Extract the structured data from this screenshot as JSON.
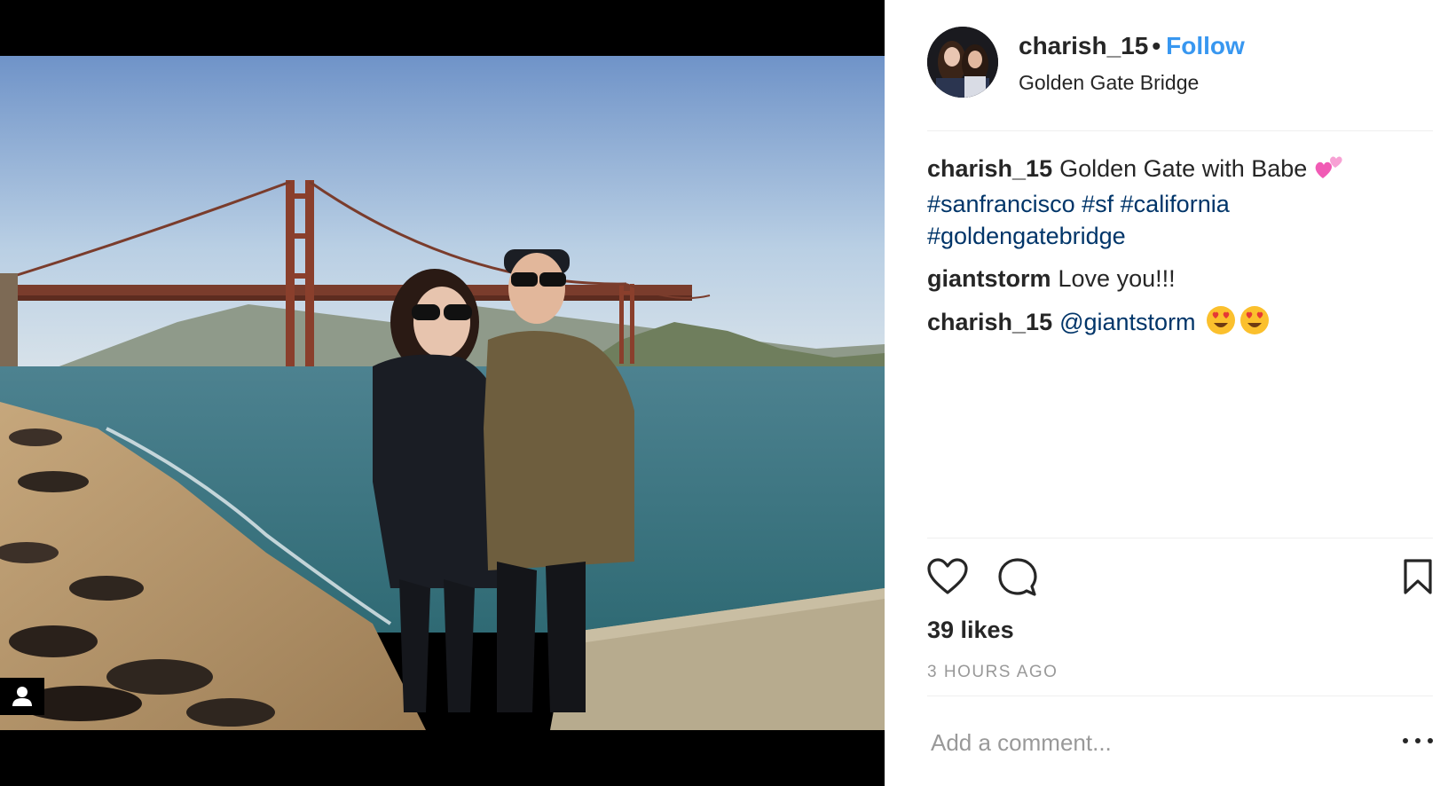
{
  "post": {
    "username": "charish_15",
    "separator": "•",
    "follow_label": "Follow",
    "location": "Golden Gate Bridge",
    "likes": "39 likes",
    "timestamp": "3 HOURS AGO"
  },
  "comments": [
    {
      "user": "charish_15",
      "text": "Golden Gate with Babe",
      "emoji": "two-hearts-icon",
      "hashtags": [
        "#sanfrancisco",
        "#sf",
        "#california",
        "#goldengatebridge"
      ]
    },
    {
      "user": "giantstorm",
      "text": "Love you!!!"
    },
    {
      "user": "charish_15",
      "mention": "@giantstorm",
      "emoji": "heart-eyes-icon"
    }
  ],
  "comment_box": {
    "placeholder": "Add a comment..."
  },
  "colors": {
    "link": "#3897f0",
    "hashtag": "#003569",
    "text": "#262626",
    "muted": "#999999",
    "divider": "#efefef"
  }
}
